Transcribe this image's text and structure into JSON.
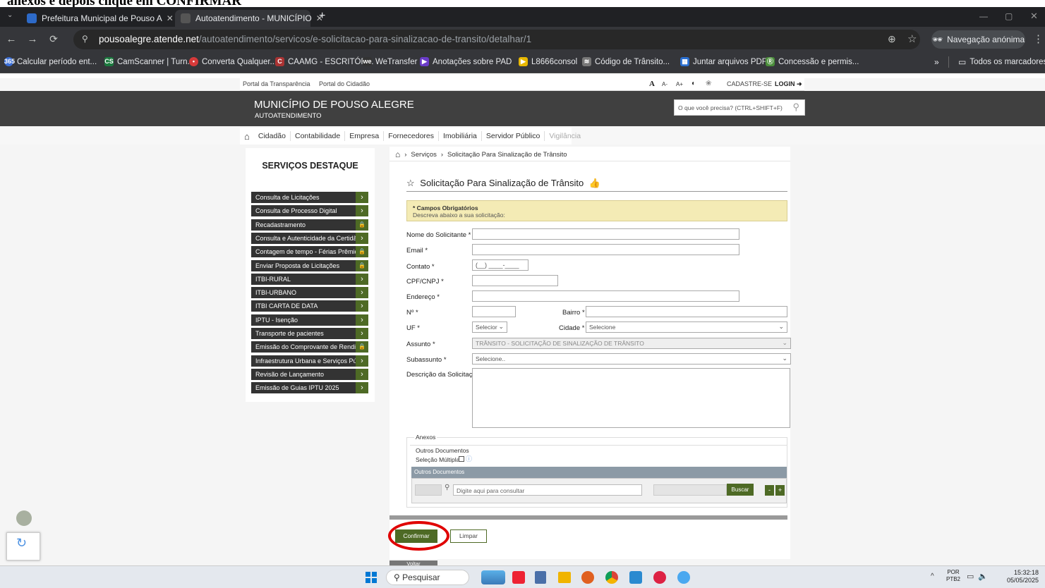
{
  "caption": "anexos e depois clique em CONFIRMAR",
  "browser": {
    "tabs": [
      {
        "title": "Prefeitura Municipal de Pouso A",
        "active": false
      },
      {
        "title": "Autoatendimento - MUNICÍPIO",
        "active": true
      }
    ],
    "new_tab": "+",
    "url_domain": "pousoalegre.atende.net",
    "url_path": "/autoatendimento/servicos/e-solicitacao-para-sinalizacao-de-transito/detalhar/1",
    "incognito_label": "Navegação anónima",
    "bookmarks": [
      "Calcular período ent...",
      "CamScanner | Turn...",
      "Converta Qualquer...",
      "CAAMG - ESCRITÓR...",
      "WeTransfer",
      "Anotações sobre PAD",
      "L8666consol",
      "Código de Trânsito...",
      "Juntar arquivos PDF",
      "Concessão e permis..."
    ],
    "all_bookmarks": "Todos os marcadores"
  },
  "site": {
    "top_links": [
      "Portal da Transparência",
      "Portal do Cidadão"
    ],
    "font_controls": [
      "A",
      "A-",
      "A+"
    ],
    "register": "CADASTRE-SE",
    "login": "LOGIN",
    "title": "MUNICÍPIO DE POUSO ALEGRE",
    "subtitle": "AUTOATENDIMENTO",
    "search_placeholder": "O que você precisa? (CTRL+SHIFT+F)",
    "menu": [
      "Cidadão",
      "Contabilidade",
      "Empresa",
      "Fornecedores",
      "Imobiliária",
      "Servidor Público",
      "Vigilância"
    ]
  },
  "sidebar": {
    "title": "SERVIÇOS DESTAQUE",
    "items": [
      {
        "label": "Consulta de Licitações",
        "locked": false
      },
      {
        "label": "Consulta de Processo Digital",
        "locked": false
      },
      {
        "label": "Recadastramento",
        "locked": true
      },
      {
        "label": "Consulta e Autenticidade da Certidão ...",
        "locked": false
      },
      {
        "label": "Contagem de tempo - Férias Prêmio",
        "locked": true
      },
      {
        "label": "Enviar Proposta de Licitações",
        "locked": true
      },
      {
        "label": "ITBI-RURAL",
        "locked": false
      },
      {
        "label": "ITBI-URBANO",
        "locked": false
      },
      {
        "label": "ITBI CARTA DE DATA",
        "locked": false
      },
      {
        "label": "IPTU - Isenção",
        "locked": false
      },
      {
        "label": "Transporte de pacientes",
        "locked": false
      },
      {
        "label": "Emissão do Comprovante de Rendime...",
        "locked": true
      },
      {
        "label": "Infraestrutura Urbana e Serviços Públi...",
        "locked": false
      },
      {
        "label": "Revisão de Lançamento",
        "locked": false
      },
      {
        "label": "Emissão de Guias IPTU 2025",
        "locked": false
      }
    ]
  },
  "breadcrumb": [
    "Serviços",
    "Solicitação Para Sinalização de Trânsito"
  ],
  "form": {
    "title": "Solicitação Para Sinalização de Trânsito",
    "required_notice": "* Campos Obrigatórios",
    "instruction": "Descreva abaixo a sua solicitação:",
    "fields": {
      "name": "Nome do Solicitante *",
      "email": "Email *",
      "contact": "Contato *",
      "contact_mask": "(__) ____-____",
      "cpf": "CPF/CNPJ *",
      "address": "Endereço *",
      "number": "Nº *",
      "district": "Bairro *",
      "uf": "UF *",
      "uf_value": "Selecior",
      "city": "Cidade *",
      "city_value": "Selecione",
      "subject": "Assunto *",
      "subject_value": "TRÂNSITO - SOLICITAÇÃO DE SINALIZAÇÃO DE TRÂNSITO",
      "subsubject": "Subassunto *",
      "subsubject_value": "Selecione..",
      "description": "Descrição da Solicitação *"
    },
    "attachments": {
      "legend": "Anexos",
      "other_docs": "Outros Documentos",
      "multi_select": "Seleção Múltipla:",
      "table_header": "Outros Documentos",
      "search_placeholder": "Digite aqui para consultar",
      "search_button": "Buscar",
      "minus": "-",
      "plus": "+"
    },
    "confirm": "Confirmar",
    "clear": "Limpar",
    "back": "Voltar"
  },
  "taskbar": {
    "search": "Pesquisar",
    "lang1": "POR",
    "lang2": "PTB2",
    "time": "15:32:18",
    "date": "05/05/2025"
  },
  "colors": {
    "accent_green": "#4e6a25",
    "header_dark": "#404040",
    "highlight_red": "#e00000"
  }
}
